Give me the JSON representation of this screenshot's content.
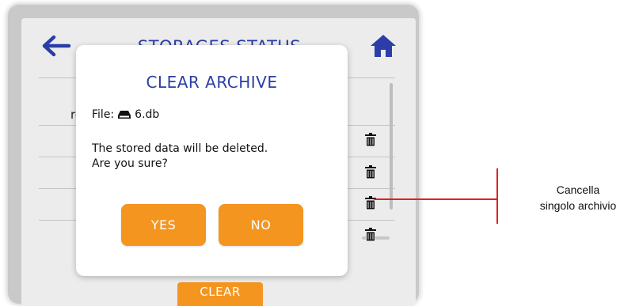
{
  "screen": {
    "title": "STORAGES STATUS",
    "partial_row_text": "re",
    "clear_button_label": "CLEAR"
  },
  "dialog": {
    "title": "CLEAR ARCHIVE",
    "file_label": "File:",
    "file_name": "6.db",
    "message_line1": "The stored data will be deleted.",
    "message_line2": "Are you sure?",
    "yes_label": "YES",
    "no_label": "NO"
  },
  "annotation": {
    "line1": "Cancella",
    "line2": "singolo archivio",
    "color": "#e02020"
  },
  "colors": {
    "accent_orange": "#f4951f",
    "title_blue": "#2b3da6"
  },
  "icons": [
    "back-arrow-icon",
    "home-icon",
    "drive-icon",
    "trash-icon"
  ]
}
